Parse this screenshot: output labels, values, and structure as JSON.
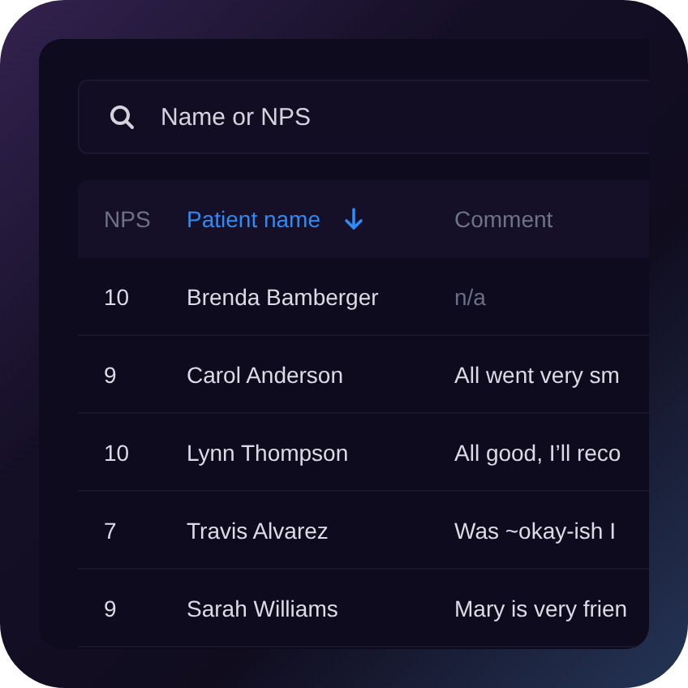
{
  "search": {
    "placeholder": "Name or NPS"
  },
  "table": {
    "columns": [
      {
        "label": "NPS",
        "sorted": false
      },
      {
        "label": "Patient name",
        "sorted": true
      },
      {
        "label": "Comment",
        "sorted": false
      }
    ],
    "rows": [
      {
        "nps": "10",
        "name": "Brenda Bamberger",
        "comment": "n/a",
        "muted": true
      },
      {
        "nps": "9",
        "name": "Carol Anderson",
        "comment": "All went very sm",
        "muted": false
      },
      {
        "nps": "10",
        "name": "Lynn Thompson",
        "comment": "All good, I’ll reco",
        "muted": false
      },
      {
        "nps": "7",
        "name": "Travis Alvarez",
        "comment": "Was ~okay-ish I",
        "muted": false
      },
      {
        "nps": "9",
        "name": "Sarah Williams",
        "comment": "Mary is very frien",
        "muted": false
      }
    ]
  }
}
